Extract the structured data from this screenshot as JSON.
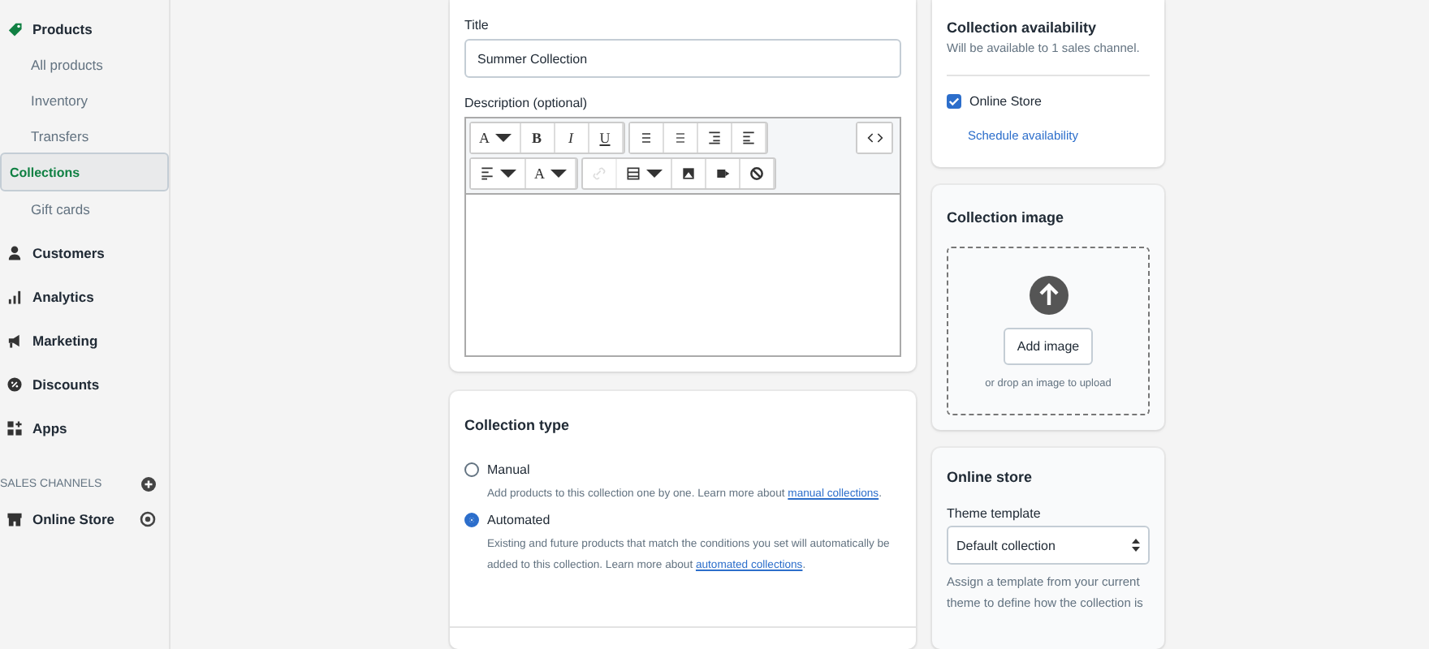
{
  "sidebar": {
    "items": [
      {
        "label": "Products",
        "selected": false,
        "children": [
          {
            "label": "All products",
            "selected": false
          },
          {
            "label": "Inventory",
            "selected": false
          },
          {
            "label": "Transfers",
            "selected": false
          },
          {
            "label": "Collections",
            "selected": true
          },
          {
            "label": "Gift cards",
            "selected": false
          }
        ]
      },
      {
        "label": "Customers",
        "selected": false
      },
      {
        "label": "Analytics",
        "selected": false
      },
      {
        "label": "Marketing",
        "selected": false
      },
      {
        "label": "Discounts",
        "selected": false
      },
      {
        "label": "Apps",
        "selected": false
      }
    ],
    "sales_channels": {
      "heading": "SALES CHANNELS",
      "items": [
        {
          "label": "Online Store"
        }
      ]
    }
  },
  "details": {
    "title_label": "Title",
    "title_value": "Summer Collection",
    "description_label": "Description (optional)",
    "toolbar": [
      [
        [
          {
            "kind": "dropdown",
            "label": "A"
          },
          {
            "kind": "text",
            "label": "B"
          },
          {
            "kind": "text",
            "label": "I"
          },
          {
            "kind": "text",
            "label": "U"
          }
        ],
        [
          {
            "kind": "icon",
            "disabled": false
          },
          {
            "kind": "icon",
            "disabled": false
          },
          {
            "kind": "icon",
            "disabled": false
          },
          {
            "kind": "icon",
            "disabled": false
          }
        ]
      ],
      [
        [
          {
            "kind": "dropdown"
          },
          {
            "kind": "dropdown",
            "label": "A"
          }
        ],
        [
          {
            "kind": "icon",
            "disabled": true
          },
          {
            "kind": "dropdown"
          },
          {
            "kind": "icon",
            "disabled": false
          },
          {
            "kind": "icon",
            "disabled": false
          },
          {
            "kind": "icon",
            "disabled": false
          }
        ]
      ]
    ]
  },
  "collection_type": {
    "title": "Collection type",
    "options": [
      {
        "label": "Manual",
        "selected": false,
        "description": "Add products to this collection one by one. Learn more about ",
        "link": "manual collections",
        "after": "."
      },
      {
        "label": "Automated",
        "selected": true,
        "description": "Existing and future products that match the conditions you set will automatically be added to this collection. Learn more about ",
        "link": "automated collections",
        "after": "."
      }
    ]
  },
  "availability": {
    "title": "Collection availability",
    "subtitle": "Will be available to 1 sales channel.",
    "channels": [
      {
        "label": "Online Store",
        "checked": true
      }
    ],
    "schedule_link": "Schedule availability"
  },
  "collection_image": {
    "title": "Collection image",
    "button": "Add image",
    "hint": "or drop an image to upload"
  },
  "online_store": {
    "title": "Online store",
    "template_label": "Theme template",
    "template_value": "Default collection",
    "help": "Assign a template from your current theme to define how the collection is"
  }
}
